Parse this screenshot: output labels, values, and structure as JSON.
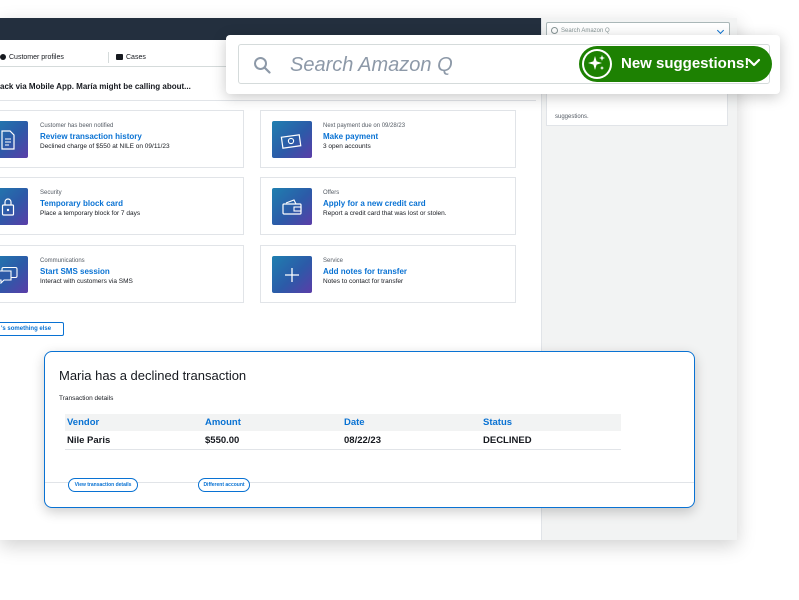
{
  "side_panel": {
    "search_placeholder": "Search Amazon Q",
    "card_text": "suggestions."
  },
  "tabs": [
    {
      "label": "Customer profiles",
      "icon": "user-icon"
    },
    {
      "label": "Cases",
      "icon": "briefcase-icon"
    }
  ],
  "context_text": "ack via Mobile App. María might be calling about...",
  "actions": [
    {
      "category": "Customer has been notified",
      "title": "Review transaction history",
      "description": "Declined charge of $550 at NILE on 09/11/23",
      "icon": "document-icon"
    },
    {
      "category": "Next payment due on 09/28/23",
      "title": "Make payment",
      "description": "3 open accounts",
      "icon": "cash-icon"
    },
    {
      "category": "Security",
      "title": "Temporary block card",
      "description": "Place a temporary block for 7 days",
      "icon": "lock-icon"
    },
    {
      "category": "Offers",
      "title": "Apply for a new credit card",
      "description": "Report a credit card that was lost or stolen.",
      "icon": "wallet-icon"
    },
    {
      "category": "Communications",
      "title": "Start SMS session",
      "description": "Interact with customers via SMS",
      "icon": "chat-icon"
    },
    {
      "category": "Service",
      "title": "Add notes for transfer",
      "description": "Notes to contact for transfer",
      "icon": "plus-icon"
    }
  ],
  "something_else_label": "'s something else",
  "q_search": {
    "placeholder": "Search Amazon Q",
    "suggestions_label": "New suggestions!",
    "badge_icon": "sparkle-icon"
  },
  "transaction_panel": {
    "title": "Maria has a declined transaction",
    "subtitle": "Transaction details",
    "columns": [
      "Vendor",
      "Amount",
      "Date",
      "Status"
    ],
    "rows": [
      [
        "Nile Paris",
        "$550.00",
        "08/22/23",
        "DECLINED"
      ]
    ],
    "buttons": [
      "View transaction details",
      "Different account"
    ]
  },
  "colors": {
    "topbar": "#232f3e",
    "link_blue": "#0972d3",
    "success_green": "#1d8102"
  }
}
